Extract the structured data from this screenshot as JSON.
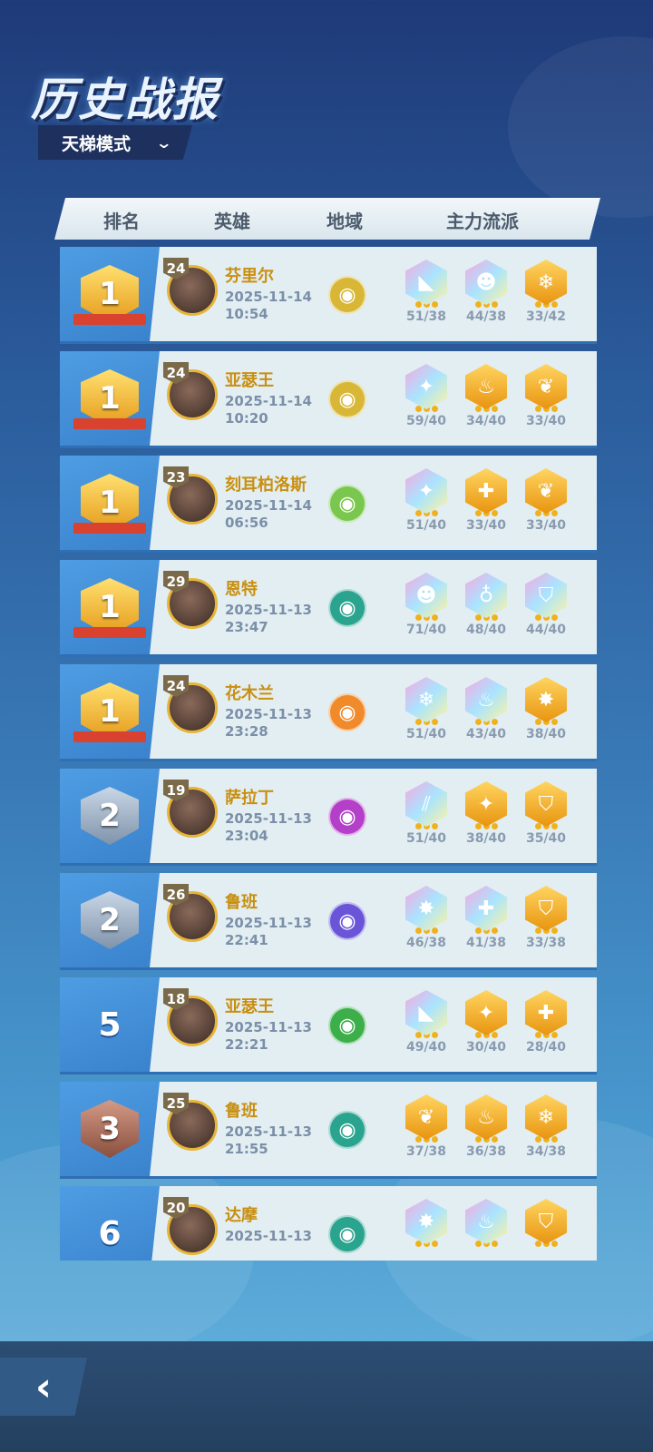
{
  "title": "历史战报",
  "mode_label": "天梯模式",
  "headers": {
    "rank": "排名",
    "hero": "英雄",
    "region": "地域",
    "faction": "主力流派"
  },
  "rows": [
    {
      "rank": "1",
      "rank_type": "gold",
      "level": "24",
      "hero": "芬里尔",
      "date": "2025-11-14",
      "time": "10:54",
      "region_icon": "spiral-icon",
      "region_color": "#d8b736",
      "factions": [
        {
          "icon": "boot-icon",
          "glyph": "◣",
          "style": "rainbow",
          "count": "51/38"
        },
        {
          "icon": "face-icon",
          "glyph": "☻",
          "style": "rainbow",
          "count": "44/38"
        },
        {
          "icon": "snowflake-icon",
          "glyph": "❄",
          "style": "gold",
          "count": "33/42"
        }
      ]
    },
    {
      "rank": "1",
      "rank_type": "gold",
      "level": "24",
      "hero": "亚瑟王",
      "date": "2025-11-14",
      "time": "10:20",
      "region_icon": "spiral-icon",
      "region_color": "#d8b736",
      "factions": [
        {
          "icon": "sparkle-icon",
          "glyph": "✦",
          "style": "rainbow",
          "count": "59/40"
        },
        {
          "icon": "flame-icon",
          "glyph": "♨",
          "style": "gold",
          "count": "34/40"
        },
        {
          "icon": "leaf-icon",
          "glyph": "❦",
          "style": "gold",
          "count": "33/40"
        }
      ]
    },
    {
      "rank": "1",
      "rank_type": "gold",
      "level": "23",
      "hero": "刻耳柏洛斯",
      "date": "2025-11-14",
      "time": "06:56",
      "region_icon": "pentagram-icon",
      "region_color": "#7ac74f",
      "factions": [
        {
          "icon": "sparkle-icon",
          "glyph": "✦",
          "style": "rainbow",
          "count": "51/40"
        },
        {
          "icon": "cross-icon",
          "glyph": "✚",
          "style": "gold",
          "count": "33/40"
        },
        {
          "icon": "leaf-icon",
          "glyph": "❦",
          "style": "gold",
          "count": "33/40"
        }
      ]
    },
    {
      "rank": "1",
      "rank_type": "gold",
      "level": "29",
      "hero": "恩特",
      "date": "2025-11-13",
      "time": "23:47",
      "region_icon": "tree-icon",
      "region_color": "#2aa38f",
      "factions": [
        {
          "icon": "face-icon",
          "glyph": "☻",
          "style": "rainbow",
          "count": "71/40"
        },
        {
          "icon": "potion-icon",
          "glyph": "♁",
          "style": "rainbow",
          "count": "48/40"
        },
        {
          "icon": "shield-icon",
          "glyph": "⛉",
          "style": "rainbow",
          "count": "44/40"
        }
      ]
    },
    {
      "rank": "1",
      "rank_type": "gold",
      "level": "24",
      "hero": "花木兰",
      "date": "2025-11-13",
      "time": "23:28",
      "region_icon": "torii-icon",
      "region_color": "#f08a2a",
      "factions": [
        {
          "icon": "snowflake-icon",
          "glyph": "❄",
          "style": "rainbow",
          "count": "51/40"
        },
        {
          "icon": "flame-icon",
          "glyph": "♨",
          "style": "rainbow",
          "count": "43/40"
        },
        {
          "icon": "sword-burst-icon",
          "glyph": "✸",
          "style": "gold",
          "count": "38/40"
        }
      ]
    },
    {
      "rank": "2",
      "rank_type": "silver",
      "level": "19",
      "hero": "萨拉丁",
      "date": "2025-11-13",
      "time": "23:04",
      "region_icon": "gear-icon",
      "region_color": "#b43fc8",
      "factions": [
        {
          "icon": "claw-icon",
          "glyph": "⫽",
          "style": "rainbow",
          "count": "51/40"
        },
        {
          "icon": "sparkle-icon",
          "glyph": "✦",
          "style": "gold",
          "count": "38/40"
        },
        {
          "icon": "shield-icon",
          "glyph": "⛉",
          "style": "gold",
          "count": "35/40"
        }
      ]
    },
    {
      "rank": "2",
      "rank_type": "silver",
      "level": "26",
      "hero": "鲁班",
      "date": "2025-11-13",
      "time": "22:41",
      "region_icon": "eye-icon",
      "region_color": "#6a55d8",
      "factions": [
        {
          "icon": "sword-burst-icon",
          "glyph": "✸",
          "style": "rainbow",
          "count": "46/38"
        },
        {
          "icon": "cross-icon",
          "glyph": "✚",
          "style": "rainbow",
          "count": "41/38"
        },
        {
          "icon": "shield-icon",
          "glyph": "⛉",
          "style": "gold",
          "count": "33/38"
        }
      ]
    },
    {
      "rank": "5",
      "rank_type": "plain",
      "level": "18",
      "hero": "亚瑟王",
      "date": "2025-11-13",
      "time": "22:21",
      "region_icon": "sprout-icon",
      "region_color": "#3cae4a",
      "factions": [
        {
          "icon": "boot-icon",
          "glyph": "◣",
          "style": "rainbow",
          "count": "49/40"
        },
        {
          "icon": "sparkle-icon",
          "glyph": "✦",
          "style": "gold",
          "count": "30/40"
        },
        {
          "icon": "cross-icon",
          "glyph": "✚",
          "style": "gold",
          "count": "28/40"
        }
      ]
    },
    {
      "rank": "3",
      "rank_type": "bronze",
      "level": "25",
      "hero": "鲁班",
      "date": "2025-11-13",
      "time": "21:55",
      "region_icon": "tree-icon",
      "region_color": "#2aa38f",
      "factions": [
        {
          "icon": "leaf-icon",
          "glyph": "❦",
          "style": "gold",
          "count": "37/38"
        },
        {
          "icon": "flame-icon",
          "glyph": "♨",
          "style": "gold",
          "count": "36/38"
        },
        {
          "icon": "snowflake-icon",
          "glyph": "❄",
          "style": "gold",
          "count": "34/38"
        }
      ]
    },
    {
      "rank": "6",
      "rank_type": "plain",
      "level": "20",
      "hero": "达摩",
      "date": "2025-11-13",
      "time": "",
      "region_icon": "tree-icon",
      "region_color": "#2aa38f",
      "factions": [
        {
          "icon": "sword-burst-icon",
          "glyph": "✸",
          "style": "rainbow",
          "count": ""
        },
        {
          "icon": "flame-icon",
          "glyph": "♨",
          "style": "rainbow",
          "count": ""
        },
        {
          "icon": "shield-icon",
          "glyph": "⛉",
          "style": "gold",
          "count": ""
        }
      ]
    }
  ],
  "back_icon": "chevron-left-icon"
}
